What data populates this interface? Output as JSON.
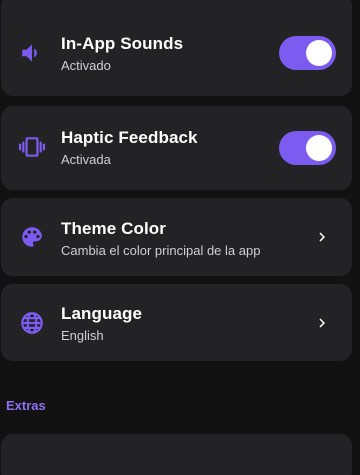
{
  "colors": {
    "accent": "#7c5cf0",
    "card": "#232326",
    "background": "#121212"
  },
  "settings": {
    "sounds": {
      "icon": "volume-icon",
      "title": "In-App Sounds",
      "subtitle": "Activado",
      "enabled": true
    },
    "haptic": {
      "icon": "vibration-icon",
      "title": "Haptic Feedback",
      "subtitle": "Activada",
      "enabled": true
    },
    "theme": {
      "icon": "palette-icon",
      "title": "Theme Color",
      "subtitle": "Cambia el color principal de la app"
    },
    "language": {
      "icon": "globe-icon",
      "title": "Language",
      "subtitle": "English"
    }
  },
  "extras": {
    "header": "Extras"
  }
}
